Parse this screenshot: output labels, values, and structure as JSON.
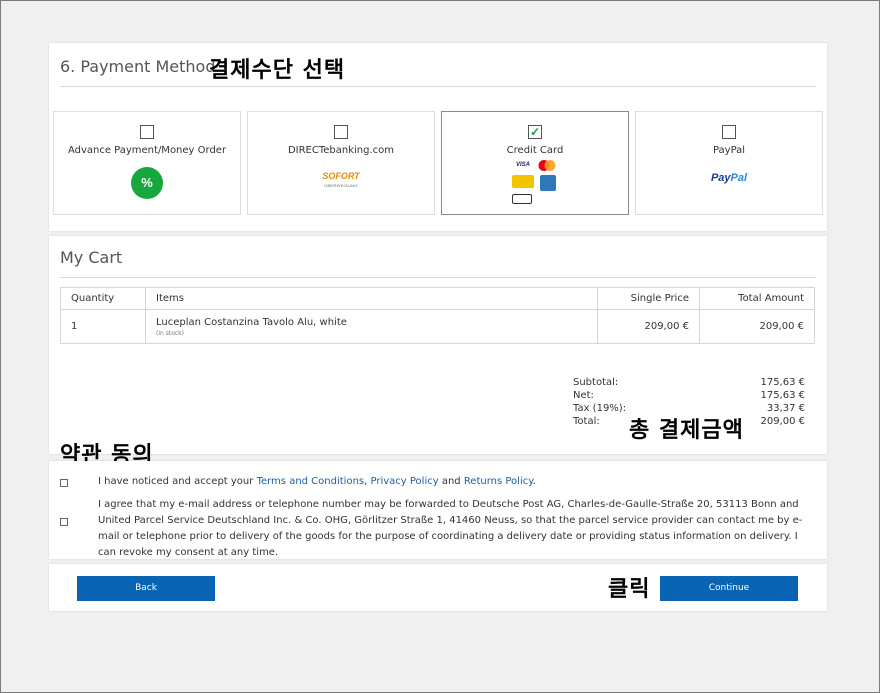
{
  "annotations": {
    "select_payment": "결제수단 선택",
    "agree_terms": "약관 동의",
    "total_amount": "총 결제금액",
    "click": "클릭"
  },
  "payment": {
    "title": "6. Payment Method",
    "methods": [
      {
        "label": "Advance Payment/Money Order",
        "icon": "percent-icon",
        "checked": false
      },
      {
        "label": "DIRECTebanking.com",
        "icon": "sofort-logo",
        "logo_text": "SOFORT",
        "logo_sub": "ÜBERWEISUNG",
        "checked": false
      },
      {
        "label": "Credit Card",
        "icon": "credit-card-logos",
        "brands": [
          "VISA",
          "mastercard",
          "JCB",
          "AMEX",
          "giropay"
        ],
        "checked": true
      },
      {
        "label": "PayPal",
        "icon": "paypal-logo",
        "logo_text_a": "Pay",
        "logo_text_b": "Pal",
        "checked": false
      }
    ]
  },
  "cart": {
    "title": "My Cart",
    "headers": {
      "quantity": "Quantity",
      "items": "Items",
      "single_price": "Single Price",
      "total_amount": "Total Amount"
    },
    "rows": [
      {
        "quantity": "1",
        "item": "Luceplan Costanzina Tavolo Alu, white",
        "availability": "(in stock)",
        "single_price": "209,00 €",
        "total": "209,00 €"
      }
    ],
    "totals": {
      "subtotal_label": "Subtotal:",
      "subtotal": "175,63 €",
      "net_label": "Net:",
      "net": "175,63 €",
      "tax_label": "Tax (19%):",
      "tax": "33,37 €",
      "total_label": "Total:",
      "total": "209,00 €"
    }
  },
  "terms": {
    "line1_prefix": "I have noticed and accept your ",
    "terms_link": "Terms and Conditions",
    "sep": ", ",
    "privacy_link": "Privacy Policy",
    "and": " and ",
    "returns_link": "Returns Policy",
    "period": ".",
    "line2": "I agree that my e-mail address or telephone number may be forwarded to Deutsche Post AG, Charles-de-Gaulle-Straße 20, 53113 Bonn and United Parcel Service Deutschland Inc. & Co. OHG, Görlitzer Straße 1, 41460 Neuss, so that the parcel service provider can contact me by e-mail or telephone prior to delivery of the goods for the purpose of coordinating a delivery date or providing status information on delivery. I can revoke my consent at any time."
  },
  "buttons": {
    "back": "Back",
    "continue": "Continue"
  },
  "colors": {
    "button": "#0a64b4",
    "check": "#1a9a4a",
    "link": "#1f5fa0"
  }
}
